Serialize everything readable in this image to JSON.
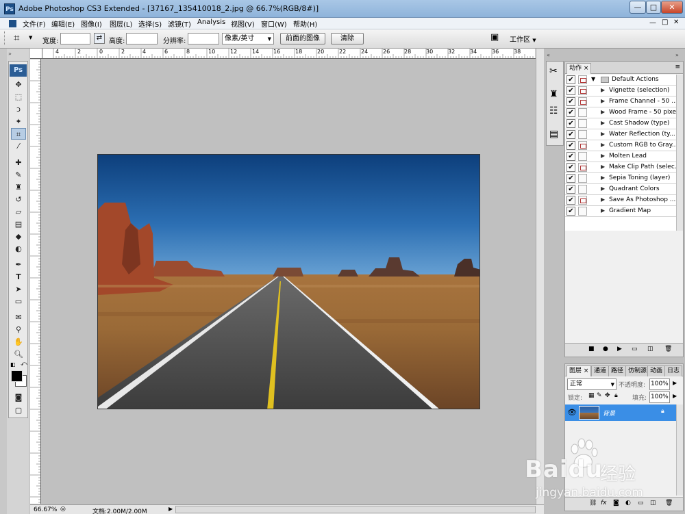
{
  "window": {
    "app_icon": "Ps",
    "title": "Adobe Photoshop CS3 Extended - [37167_135410018_2.jpg @ 66.7%(RGB/8#)]",
    "min_glyph": "—",
    "max_glyph": "□",
    "close_glyph": "✕"
  },
  "menu": [
    "文件(F)",
    "编辑(E)",
    "图像(I)",
    "图层(L)",
    "选择(S)",
    "滤镜(T)",
    "Analysis",
    "视图(V)",
    "窗口(W)",
    "帮助(H)"
  ],
  "options": {
    "width_label": "宽度:",
    "height_label": "高度:",
    "resolution_label": "分辨率:",
    "unit_value": "像素/英寸",
    "front_image_button": "前面的图像",
    "clear_button": "清除",
    "workspace_label": "工作区"
  },
  "ruler_top_labels": [
    "4",
    "2",
    "0",
    "2",
    "4",
    "6",
    "8",
    "10",
    "12",
    "14",
    "16",
    "18",
    "20",
    "22",
    "24",
    "26",
    "28",
    "30",
    "32",
    "34",
    "36",
    "38",
    "40"
  ],
  "toolbar_logo": "Ps",
  "status": {
    "zoom": "66.67%",
    "doc": "文档:2.00M/2.00M"
  },
  "actions_panel": {
    "tab": "动作",
    "set_name": "Default Actions",
    "items": [
      {
        "label": "Vignette (selection)",
        "dialog": true
      },
      {
        "label": "Frame Channel - 50 ...",
        "dialog": true
      },
      {
        "label": "Wood Frame - 50 pixel",
        "dialog": false
      },
      {
        "label": "Cast Shadow (type)",
        "dialog": false
      },
      {
        "label": "Water Reflection (ty...",
        "dialog": false
      },
      {
        "label": "Custom RGB to Gray...",
        "dialog": true
      },
      {
        "label": "Molten Lead",
        "dialog": false
      },
      {
        "label": "Make Clip Path (selec...",
        "dialog": true
      },
      {
        "label": "Sepia Toning (layer)",
        "dialog": false
      },
      {
        "label": "Quadrant Colors",
        "dialog": false
      },
      {
        "label": "Save As Photoshop ...",
        "dialog": true
      },
      {
        "label": "Gradient Map",
        "dialog": false
      }
    ]
  },
  "layers_panel": {
    "tabs": [
      "图层",
      "通道",
      "路径",
      "仿制源",
      "动画",
      "日志"
    ],
    "blend_mode": "正常",
    "opacity_label": "不透明度:",
    "opacity_value": "100%",
    "lock_label": "锁定:",
    "fill_label": "填充:",
    "fill_value": "100%",
    "layer_name": "背景"
  },
  "watermark": {
    "brand": "Baidu",
    "tag": "经验",
    "url": "jingyan.baidu.com"
  }
}
